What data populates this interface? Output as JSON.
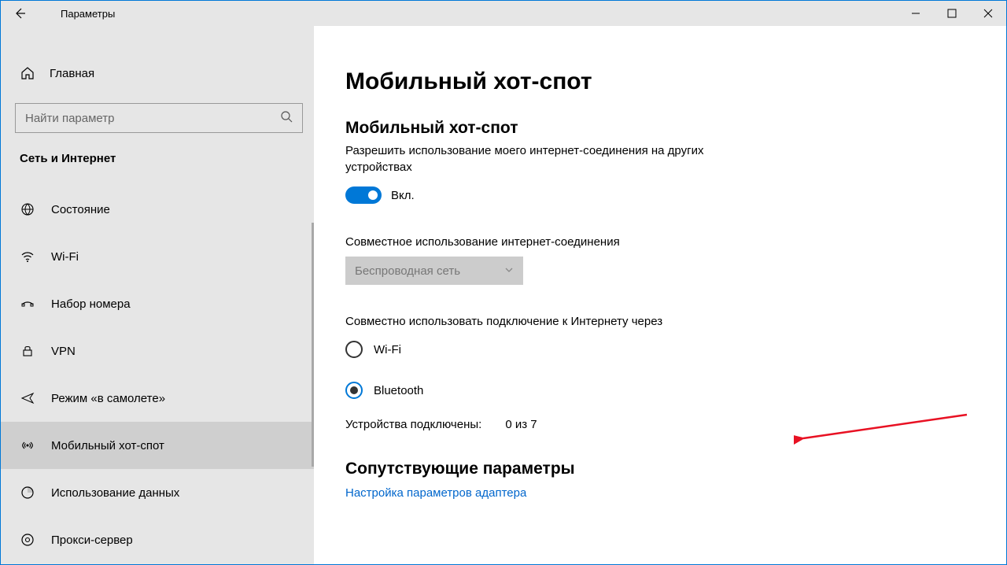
{
  "title": "Параметры",
  "sidebar": {
    "home": "Главная",
    "search_placeholder": "Найти параметр",
    "category": "Сеть и Интернет",
    "items": [
      {
        "label": "Состояние"
      },
      {
        "label": "Wi-Fi"
      },
      {
        "label": "Набор номера"
      },
      {
        "label": "VPN"
      },
      {
        "label": "Режим «в самолете»"
      },
      {
        "label": "Мобильный хот-спот"
      },
      {
        "label": "Использование данных"
      },
      {
        "label": "Прокси-сервер"
      }
    ]
  },
  "main": {
    "heading": "Мобильный хот-спот",
    "hotspot_title": "Мобильный хот-спот",
    "hotspot_desc": "Разрешить использование моего интернет-соединения на других устройствах",
    "toggle_label": "Вкл.",
    "share_from_label": "Совместное использование интернет-соединения",
    "share_from_value": "Беспроводная сеть",
    "share_over_label": "Совместно использовать подключение к Интернету через",
    "radio_wifi": "Wi-Fi",
    "radio_bt": "Bluetooth",
    "devices_label": "Устройства подключены:",
    "devices_value": "0 из 7",
    "related_heading": "Сопутствующие параметры",
    "related_link": "Настройка параметров адаптера"
  }
}
